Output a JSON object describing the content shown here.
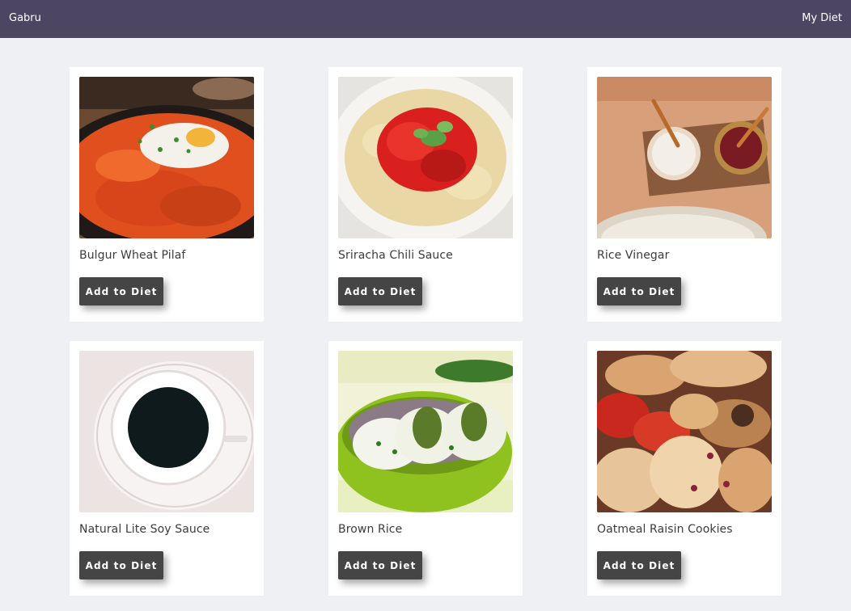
{
  "navbar": {
    "brand": "Gabru",
    "my_diet_link": "My Diet",
    "background": "#4c4662"
  },
  "foods": [
    {
      "name": "Bulgur Wheat Pilaf",
      "button_label": "Add to Diet",
      "image": "fried-rice-egg"
    },
    {
      "name": "Sriracha Chili Sauce",
      "button_label": "Add to Diet",
      "image": "pasta-tomato-sauce"
    },
    {
      "name": "Rice Vinegar",
      "button_label": "Add to Diet",
      "image": "sauce-bowls"
    },
    {
      "name": "Natural Lite Soy Sauce",
      "button_label": "Add to Diet",
      "image": "coffee-cup"
    },
    {
      "name": "Brown Rice",
      "button_label": "Add to Diet",
      "image": "rice-rolls-bowl"
    },
    {
      "name": "Oatmeal Raisin Cookies",
      "button_label": "Add to Diet",
      "image": "pastries-cookies"
    }
  ],
  "colors": {
    "page_background": "#eef0f3",
    "card_background": "#ffffff",
    "button_background": "#454545",
    "button_text": "#ffffff"
  }
}
